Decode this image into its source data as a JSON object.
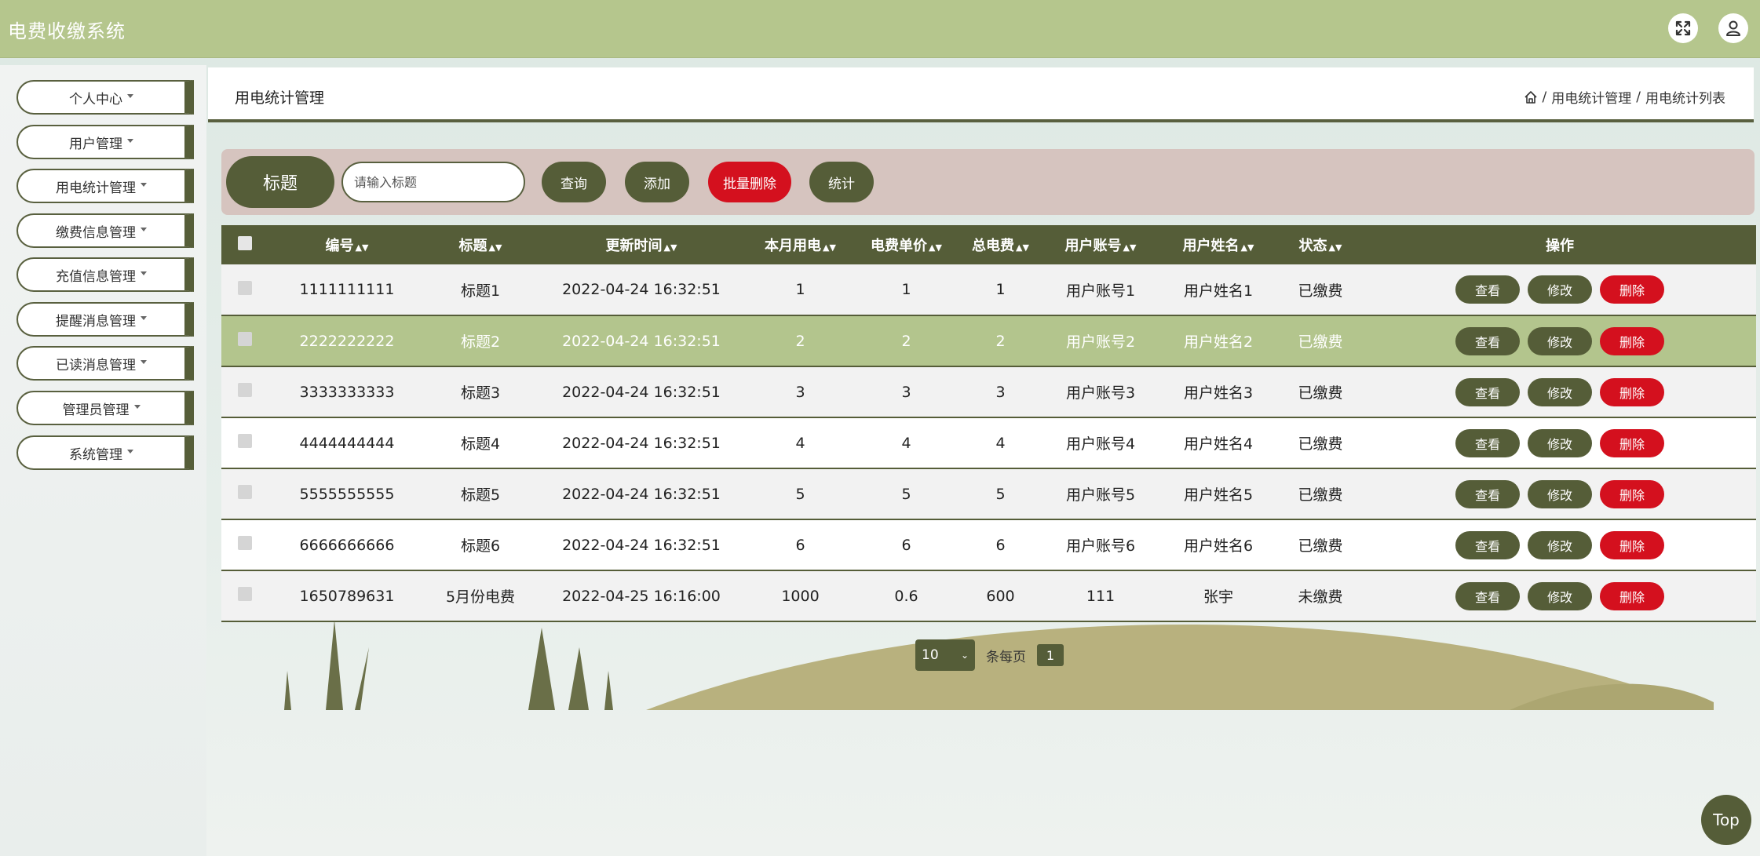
{
  "app": {
    "title": "电费收缴系统"
  },
  "header": {
    "fullscreen_icon": "expand-icon",
    "user_icon": "user-icon"
  },
  "sidebar": {
    "items": [
      {
        "label": "个人中心"
      },
      {
        "label": "用户管理"
      },
      {
        "label": "用电统计管理"
      },
      {
        "label": "缴费信息管理"
      },
      {
        "label": "充值信息管理"
      },
      {
        "label": "提醒消息管理"
      },
      {
        "label": "已读消息管理"
      },
      {
        "label": "管理员管理"
      },
      {
        "label": "系统管理"
      }
    ]
  },
  "page": {
    "title": "用电统计管理",
    "breadcrumb": [
      "用电统计管理",
      "用电统计列表"
    ],
    "breadcrumb_sep": "/"
  },
  "search": {
    "label": "标题",
    "placeholder": "请输入标题",
    "query_button": "查询",
    "add_button": "添加",
    "batch_delete_button": "批量删除",
    "stats_button": "统计"
  },
  "table": {
    "columns": [
      "编号",
      "标题",
      "更新时间",
      "本月用电",
      "电费单价",
      "总电费",
      "用户账号",
      "用户姓名",
      "状态",
      "操作"
    ],
    "rows": [
      {
        "id": "1111111111",
        "title": "标题1",
        "time": "2022-04-24 16:32:51",
        "usage": "1",
        "price": "1",
        "total": "1",
        "account": "用户账号1",
        "name": "用户姓名1",
        "status": "已缴费"
      },
      {
        "id": "2222222222",
        "title": "标题2",
        "time": "2022-04-24 16:32:51",
        "usage": "2",
        "price": "2",
        "total": "2",
        "account": "用户账号2",
        "name": "用户姓名2",
        "status": "已缴费"
      },
      {
        "id": "3333333333",
        "title": "标题3",
        "time": "2022-04-24 16:32:51",
        "usage": "3",
        "price": "3",
        "total": "3",
        "account": "用户账号3",
        "name": "用户姓名3",
        "status": "已缴费"
      },
      {
        "id": "4444444444",
        "title": "标题4",
        "time": "2022-04-24 16:32:51",
        "usage": "4",
        "price": "4",
        "total": "4",
        "account": "用户账号4",
        "name": "用户姓名4",
        "status": "已缴费"
      },
      {
        "id": "5555555555",
        "title": "标题5",
        "time": "2022-04-24 16:32:51",
        "usage": "5",
        "price": "5",
        "total": "5",
        "account": "用户账号5",
        "name": "用户姓名5",
        "status": "已缴费"
      },
      {
        "id": "6666666666",
        "title": "标题6",
        "time": "2022-04-24 16:32:51",
        "usage": "6",
        "price": "6",
        "total": "6",
        "account": "用户账号6",
        "name": "用户姓名6",
        "status": "已缴费"
      },
      {
        "id": "1650789631",
        "title": "5月份电费",
        "time": "2022-04-25 16:16:00",
        "usage": "1000",
        "price": "0.6",
        "total": "600",
        "account": "111",
        "name": "张宇",
        "status": "未缴费"
      }
    ],
    "actions": {
      "view": "查看",
      "edit": "修改",
      "delete": "删除"
    }
  },
  "pagination": {
    "page_size": "10",
    "per_page_text": "条每页",
    "current_page": "1"
  },
  "back_to_top": "Top",
  "colors": {
    "header": "#b5c68d",
    "dark": "#555d38",
    "danger": "#d4101e",
    "highlight_row": "#b3c58d",
    "searchbar": "#d6c4bf"
  }
}
